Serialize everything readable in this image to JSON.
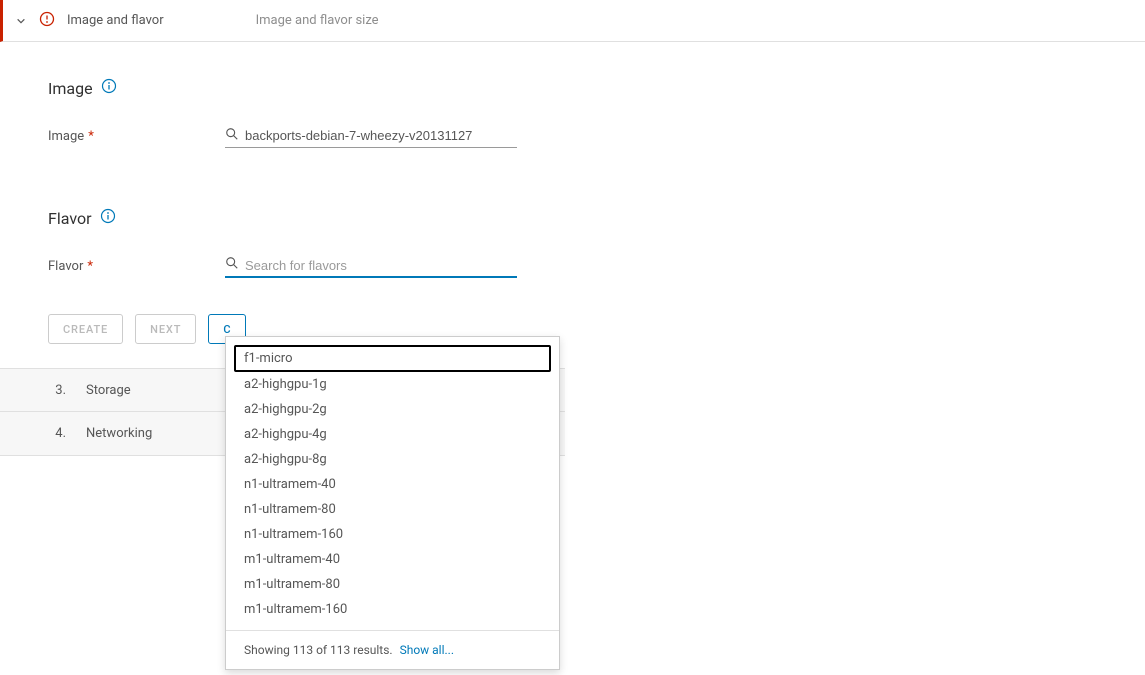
{
  "header": {
    "title": "Image and flavor",
    "subtitle": "Image and flavor size"
  },
  "image_section": {
    "heading": "Image",
    "label": "Image",
    "value": "backports-debian-7-wheezy-v20131127"
  },
  "flavor_section": {
    "heading": "Flavor",
    "label": "Flavor",
    "placeholder": "Search for flavors"
  },
  "buttons": {
    "create": "Create",
    "next": "Next",
    "cancel": "C"
  },
  "steps": [
    {
      "num": "3.",
      "label": "Storage"
    },
    {
      "num": "4.",
      "label": "Networking"
    }
  ],
  "dropdown": {
    "items": [
      "f1-micro",
      "a2-highgpu-1g",
      "a2-highgpu-2g",
      "a2-highgpu-4g",
      "a2-highgpu-8g",
      "n1-ultramem-40",
      "n1-ultramem-80",
      "n1-ultramem-160",
      "m1-ultramem-40",
      "m1-ultramem-80",
      "m1-ultramem-160"
    ],
    "highlighted_index": 0,
    "footer_text": "Showing 113 of 113 results.",
    "footer_link": "Show all..."
  }
}
